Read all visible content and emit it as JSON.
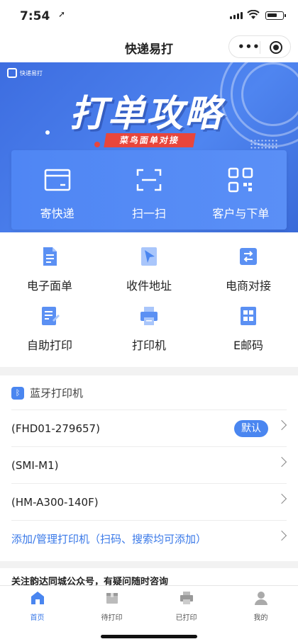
{
  "status": {
    "time": "7:54",
    "location_glyph": "➚"
  },
  "nav": {
    "title": "快递易打"
  },
  "banner": {
    "logo_text": "快递易打",
    "headline": "打单攻略",
    "ribbon": "菜鸟面单对接",
    "actions": [
      {
        "label": "寄快递",
        "icon": "box-icon"
      },
      {
        "label": "扫一扫",
        "icon": "scan-icon"
      },
      {
        "label": "客户与下单",
        "icon": "qr-code-icon"
      }
    ]
  },
  "grid": [
    {
      "label": "电子面单",
      "icon": "document-icon"
    },
    {
      "label": "收件地址",
      "icon": "location-arrow-icon"
    },
    {
      "label": "电商对接",
      "icon": "exchange-icon"
    },
    {
      "label": "自助打印",
      "icon": "edit-document-icon"
    },
    {
      "label": "打印机",
      "icon": "printer-icon"
    },
    {
      "label": "E邮码",
      "icon": "grid-code-icon"
    }
  ],
  "printers": {
    "header": "蓝牙打印机",
    "items": [
      {
        "name": "(FHD01-279657)",
        "badge": "默认"
      },
      {
        "name": "(SMI-M1)"
      },
      {
        "name": "(HM-A300-140F)"
      }
    ],
    "manage_link": "添加/管理打印机（扫码、搜索均可添加）"
  },
  "notice": "关注韵达同城公众号，有疑问随时咨询",
  "tabbar": [
    {
      "label": "首页",
      "active": true
    },
    {
      "label": "待打印"
    },
    {
      "label": "已打印"
    },
    {
      "label": "我的"
    }
  ],
  "colors": {
    "primary": "#4a86f0",
    "banner": "#3d6de0",
    "ribbon": "#e8463c"
  }
}
